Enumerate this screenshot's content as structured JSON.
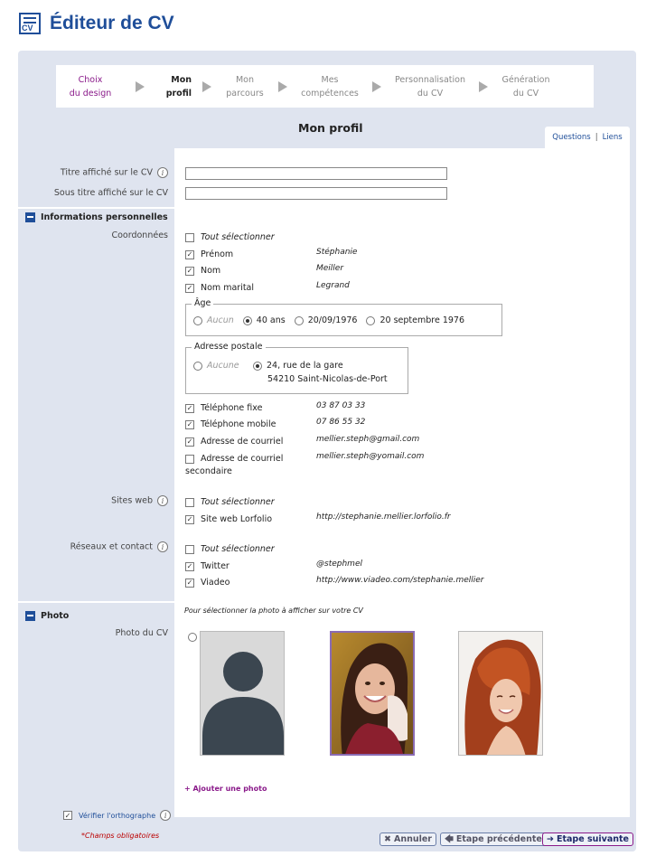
{
  "app": {
    "title": "Éditeur de CV",
    "logo_text": "CV"
  },
  "steps": [
    {
      "line1": "Choix",
      "line2": "du design",
      "state": "link"
    },
    {
      "line1": "Mon",
      "line2": "profil",
      "state": "active"
    },
    {
      "line1": "Mon",
      "line2": "parcours",
      "state": "todo"
    },
    {
      "line1": "Mes",
      "line2": "compétences",
      "state": "todo"
    },
    {
      "line1": "Personnalisation",
      "line2": "du CV",
      "state": "todo"
    },
    {
      "line1": "Génération",
      "line2": "du CV",
      "state": "todo"
    }
  ],
  "section_title": "Mon profil",
  "tabs": {
    "questions": "Questions",
    "separator": "|",
    "links": "Liens"
  },
  "cv_title_label": "Titre affiché sur le CV",
  "cv_subtitle_label": "Sous titre affiché sur le CV",
  "cv_title_value": "",
  "cv_subtitle_value": "",
  "personal": {
    "header": "Informations personnelles",
    "coords_label": "Coordonnées",
    "select_all": "Tout sélectionner",
    "fields": [
      {
        "label": "Prénom",
        "value": "Stéphanie",
        "checked": true
      },
      {
        "label": "Nom",
        "value": "Meiller",
        "checked": true
      },
      {
        "label": "Nom marital",
        "value": "Legrand",
        "checked": true
      }
    ],
    "age": {
      "legend": "Âge",
      "options": [
        {
          "label": "Aucun",
          "selected": false,
          "muted": true
        },
        {
          "label": "40 ans",
          "selected": true,
          "muted": false
        },
        {
          "label": "20/09/1976",
          "selected": false,
          "muted": false
        },
        {
          "label": "20 septembre 1976",
          "selected": false,
          "muted": false
        }
      ]
    },
    "address": {
      "legend": "Adresse postale",
      "none_label": "Aucune",
      "line1": "24, rue de la gare",
      "line2": "54210 Saint-Nicolas-de-Port"
    },
    "contact": [
      {
        "label": "Téléphone fixe",
        "value": "03 87 03 33",
        "checked": true
      },
      {
        "label": "Téléphone mobile",
        "value": "07 86 55 32",
        "checked": true
      },
      {
        "label": "Adresse de courriel",
        "value": "mellier.steph@gmail.com",
        "checked": true
      },
      {
        "label": "Adresse de courriel",
        "label2": "secondaire",
        "value": "mellier.steph@yomail.com",
        "checked": false
      }
    ]
  },
  "websites": {
    "label": "Sites web",
    "select_all": "Tout sélectionner",
    "items": [
      {
        "label": "Site web Lorfolio",
        "value": "http://stephanie.mellier.lorfolio.fr",
        "checked": true
      }
    ]
  },
  "networks": {
    "label": "Réseaux et contact",
    "select_all": "Tout sélectionner",
    "items": [
      {
        "label": "Twitter",
        "value": "@stephmel",
        "checked": true
      },
      {
        "label": "Viadeo",
        "value": "http://www.viadeo.com/stephanie.mellier",
        "checked": true
      }
    ]
  },
  "photo": {
    "header": "Photo",
    "label": "Photo du CV",
    "hint": "Pour sélectionner la photo à afficher sur votre CV",
    "selected_index": 1,
    "add": "+ Ajouter une photo"
  },
  "footer": {
    "spellcheck": "Vérifier l'orthographe",
    "required_mark": "*",
    "required": "Champs obligatoires",
    "cancel": "Annuler",
    "prev": "Etape précédente",
    "next": "Etape suivante"
  },
  "colors": {
    "accent": "#1f4e99",
    "link": "#8a1a8a",
    "panel": "#dfe4ef"
  }
}
